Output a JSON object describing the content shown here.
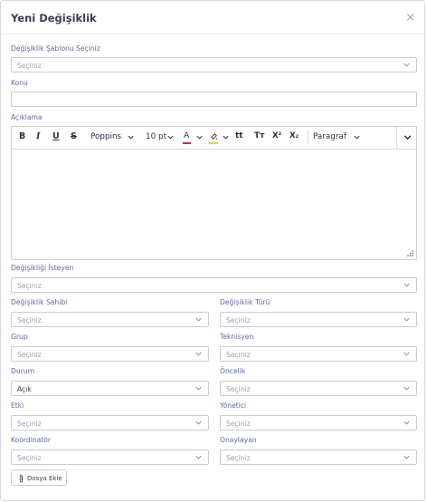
{
  "dialog": {
    "title": "Yeni Değişiklik",
    "close_icon": "×"
  },
  "placeholder": "Seçiniz",
  "fields": {
    "template": {
      "label": "Değişiklik Şablonu Seçiniz"
    },
    "subject": {
      "label": "Konu",
      "value": ""
    },
    "description": {
      "label": "Açıklama",
      "value": ""
    },
    "requester": {
      "label": "Değişikliği İsteyen"
    },
    "owner": {
      "label": "Değişiklik Sahibi"
    },
    "type": {
      "label": "Değişiklik Türü"
    },
    "group": {
      "label": "Grup"
    },
    "technician": {
      "label": "Teknisyen"
    },
    "status": {
      "label": "Durum",
      "value": "Açık"
    },
    "priority": {
      "label": "Öncelik"
    },
    "impact": {
      "label": "Etki"
    },
    "manager": {
      "label": "Yönetici"
    },
    "coordinator": {
      "label": "Koordinatör"
    },
    "approver": {
      "label": "Onaylayan"
    }
  },
  "toolbar": {
    "bold": "B",
    "italic": "I",
    "underline": "U",
    "strike": "S",
    "font": "Poppins",
    "size": "10 pt",
    "font_color": "A",
    "case1": "tt",
    "case2": "Tт",
    "superscript": "X²",
    "subscript": "X₂",
    "paragraph": "Paragraf"
  },
  "attach": {
    "label": "Dosya Ekle"
  },
  "colors": {
    "label": "#5b6aa8",
    "border": "#c9ccd6",
    "font_color_underline": "#d9262c",
    "highlight": "#f2d600"
  }
}
